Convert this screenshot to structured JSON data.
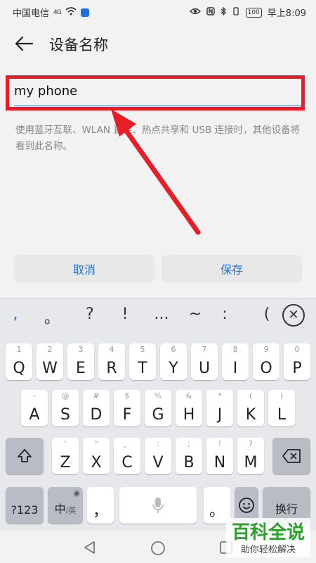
{
  "status_bar": {
    "carrier": "中国电信",
    "signal": "4G",
    "battery": "100",
    "time": "早上8:09"
  },
  "header": {
    "back_icon": "arrow-left-icon",
    "title": "设备名称"
  },
  "device_name": {
    "value": "my phone",
    "hint": "使用蓝牙互联、WLAN 直连、热点共享和 USB 连接时，其他设备将看到此名称。"
  },
  "buttons": {
    "cancel": "取消",
    "save": "保存"
  },
  "keyboard": {
    "symbol_bar": [
      ",",
      "。",
      "?",
      "!",
      "...",
      "~",
      ":",
      "("
    ],
    "row1": [
      {
        "sub": "1",
        "key": "Q"
      },
      {
        "sub": "2",
        "key": "W"
      },
      {
        "sub": "3",
        "key": "E"
      },
      {
        "sub": "4",
        "key": "R"
      },
      {
        "sub": "5",
        "key": "T"
      },
      {
        "sub": "6",
        "key": "Y"
      },
      {
        "sub": "7",
        "key": "U"
      },
      {
        "sub": "8",
        "key": "I"
      },
      {
        "sub": "9",
        "key": "O"
      },
      {
        "sub": "0",
        "key": "P"
      }
    ],
    "row2": [
      {
        "sub": "-",
        "key": "A"
      },
      {
        "sub": "@",
        "key": "S"
      },
      {
        "sub": "#",
        "key": "D"
      },
      {
        "sub": "$",
        "key": "F"
      },
      {
        "sub": "%",
        "key": "G"
      },
      {
        "sub": "&",
        "key": "H"
      },
      {
        "sub": "*",
        "key": "J"
      },
      {
        "sub": "(",
        "key": "K"
      },
      {
        "sub": ")",
        "key": "L"
      }
    ],
    "row3": [
      {
        "sub": "'",
        "key": "Z"
      },
      {
        "sub": "\"",
        "key": "X"
      },
      {
        "sub": "、",
        "key": "C"
      },
      {
        "sub": ":",
        "key": "V"
      },
      {
        "sub": ";",
        "key": "B"
      },
      {
        "sub": "!",
        "key": "N"
      },
      {
        "sub": "?",
        "key": "M"
      }
    ],
    "num_key": "?123",
    "lang_key": "中",
    "lang_sub": "/英",
    "comma_key": "，",
    "period_key": "。",
    "enter_key": "换行"
  },
  "watermark": {
    "title": "百科全说",
    "subtitle": "助你轻松解决"
  },
  "colors": {
    "accent": "#1e6fd9",
    "annotation_red": "#e61e25",
    "watermark_green": "#2aa12a"
  }
}
